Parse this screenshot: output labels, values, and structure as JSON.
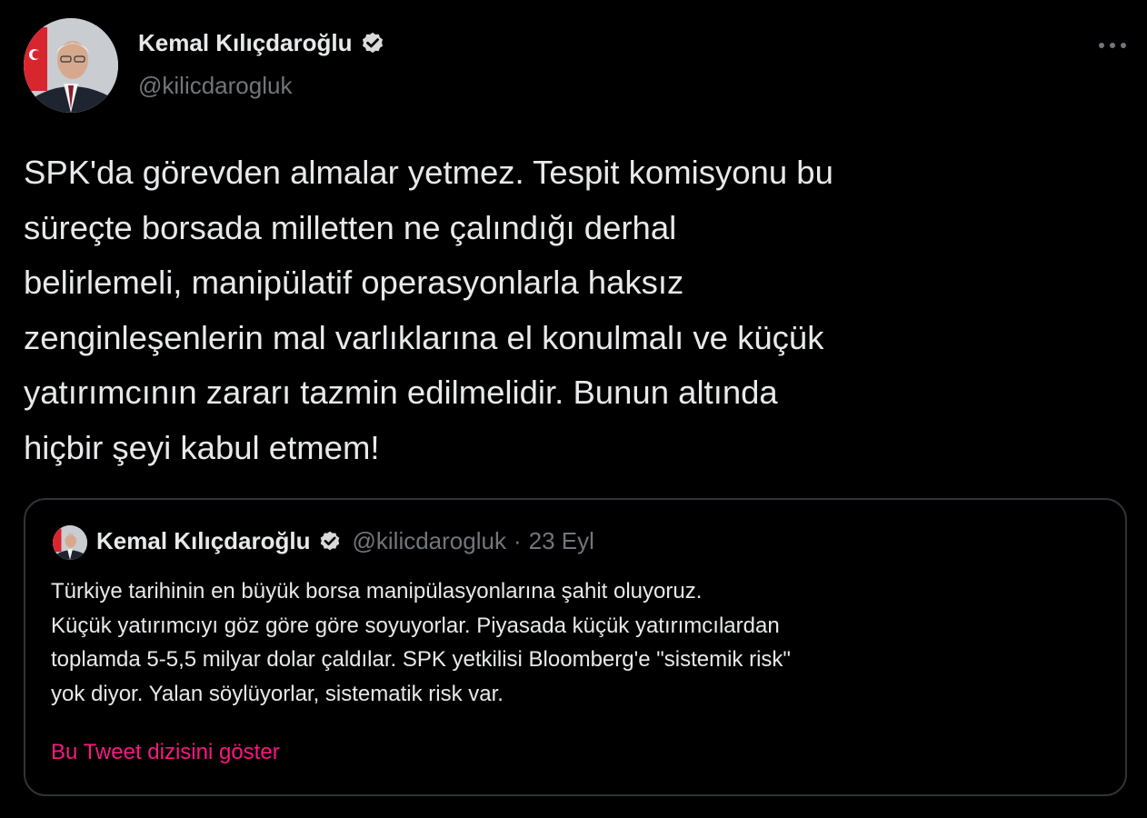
{
  "author": {
    "name": "Kemal Kılıçdaroğlu",
    "handle": "@kilicdarogluk"
  },
  "tweet": {
    "text": "SPK'da görevden almalar yetmez. Tespit komisyonu bu\nsüreçte borsada milletten ne çalındığı derhal\nbelirlemeli, manipülatif operasyonlarla haksız\nzenginleşenlerin mal varlıklarına el konulmalı ve küçük\nyatırımcının zararı tazmin edilmelidir. Bunun altında\nhiçbir şeyi kabul etmem!"
  },
  "quoted_tweet": {
    "name": "Kemal Kılıçdaroğlu",
    "handle": "@kilicdarogluk",
    "separator": "·",
    "date": "23 Eyl",
    "text": "Türkiye tarihinin en büyük borsa manipülasyonlarına şahit oluyoruz.\nKüçük yatırımcıyı göz göre göre soyuyorlar. Piyasada küçük yatırımcılardan\ntoplamda 5-5,5 milyar dolar çaldılar. SPK yetkilisi Bloomberg'e \"sistemik risk\"\nyok diyor. Yalan söylüyorlar, sistematik risk var.",
    "show_thread_label": "Bu Tweet dizisini göster"
  },
  "icons": {
    "verified": "verified-badge-icon",
    "more": "more-options-icon"
  },
  "colors": {
    "background": "#000000",
    "text_primary": "#e7e9ea",
    "text_secondary": "#71767b",
    "border": "#2f3336",
    "link_accent": "#f91880"
  }
}
